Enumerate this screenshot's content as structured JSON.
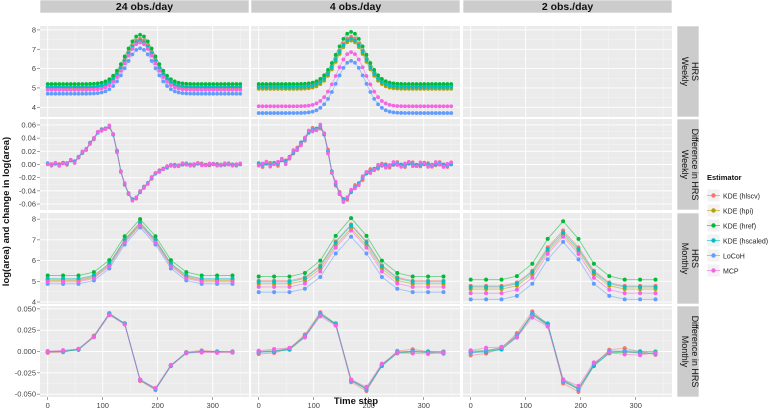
{
  "chart_data": {
    "type": "line",
    "xlabel": "Time step",
    "ylabel": "log(area) and change in log(area)",
    "columns": [
      "24 obs./day",
      "4 obs./day",
      "2 obs./day"
    ],
    "rows": [
      {
        "label": "HRS\nWeekly",
        "y_ticks": [
          4,
          5,
          6,
          7,
          8
        ],
        "ylim": [
          3.6,
          8.1
        ]
      },
      {
        "label": "Difference in HRS\nWeekly",
        "y_ticks": [
          -0.06,
          -0.04,
          -0.02,
          0.0,
          0.02,
          0.04,
          0.06
        ],
        "y_tick_labels": [
          "-0.06",
          "-0.04",
          "-0.02",
          "0.00",
          "0.02",
          "0.04",
          "0.06"
        ],
        "ylim": [
          -0.066,
          0.066
        ]
      },
      {
        "label": "HRS\nMonthly",
        "y_ticks": [
          4,
          5,
          6,
          7,
          8
        ],
        "ylim": [
          4.0,
          8.2
        ]
      },
      {
        "label": "Difference in HRS\nMonthly",
        "y_ticks": [
          -0.05,
          -0.025,
          0,
          0.025,
          0.05
        ],
        "y_tick_labels": [
          "-0.050",
          "-0.025",
          "0.000",
          "0.025",
          "0.050"
        ],
        "ylim": [
          -0.051,
          0.051
        ]
      }
    ],
    "x_ticks": [
      0,
      100,
      200,
      300
    ],
    "xlim": [
      -14,
      366
    ],
    "legend": {
      "title": "Estimator",
      "position": "right",
      "entries": [
        {
          "name": "KDE (hlscv)",
          "color": "#f8766d"
        },
        {
          "name": "KDE (hpi)",
          "color": "#b79f00"
        },
        {
          "name": "KDE (href)",
          "color": "#00ba38"
        },
        {
          "name": "KDE (hscaled)",
          "color": "#00bfc4"
        },
        {
          "name": "LoCoH",
          "color": "#619cff"
        },
        {
          "name": "MCP",
          "color": "#f564e3"
        }
      ]
    },
    "series_shape": {
      "weekly_x_step": 7,
      "weekly_x_max": 350,
      "weekly_peak": 168,
      "weekly_width": 26,
      "monthly_x": [
        0,
        28,
        56,
        84,
        112,
        140,
        168,
        196,
        224,
        252,
        280,
        308,
        336
      ]
    },
    "hrs_weekly": {
      "24 obs./day": {
        "base": [
          5.05,
          5.0,
          5.2,
          5.05,
          4.7,
          4.9
        ],
        "peak": [
          7.55,
          7.45,
          7.75,
          7.45,
          7.05,
          7.35
        ]
      },
      "4 obs./day": {
        "base": [
          5.1,
          4.95,
          5.2,
          5.05,
          3.7,
          4.05
        ],
        "peak": [
          7.65,
          7.45,
          7.9,
          7.55,
          6.4,
          6.85
        ]
      }
    },
    "hrs_monthly": {
      "24 obs./day": {
        "base": [
          5.05,
          5.0,
          5.25,
          5.1,
          4.85,
          4.95
        ],
        "peak": [
          7.85,
          7.75,
          8.0,
          7.8,
          7.6,
          7.7
        ]
      },
      "4 obs./day": {
        "base": [
          5.0,
          4.85,
          5.2,
          4.95,
          4.45,
          4.7
        ],
        "peak": [
          7.75,
          7.55,
          8.05,
          7.7,
          7.15,
          7.45
        ]
      },
      "2 obs./day": {
        "base": [
          4.75,
          4.6,
          5.05,
          4.7,
          4.1,
          4.4
        ],
        "peak": [
          7.45,
          7.25,
          7.9,
          7.35,
          6.9,
          7.15
        ]
      }
    },
    "diff_weekly": [
      0.002,
      0.0,
      0.001,
      -0.001,
      0.003,
      0.001,
      0.006,
      0.004,
      0.012,
      0.018,
      0.022,
      0.033,
      0.04,
      0.048,
      0.052,
      0.055,
      0.058,
      0.045,
      0.02,
      -0.01,
      -0.03,
      -0.045,
      -0.053,
      -0.05,
      -0.042,
      -0.035,
      -0.028,
      -0.02,
      -0.014,
      -0.01,
      -0.006,
      -0.004,
      -0.002,
      -0.001,
      -0.001,
      0.0,
      0.0,
      0.0,
      0.0,
      0.001,
      0.0,
      0.0,
      0.0,
      0.0,
      0.0,
      0.0,
      0.0,
      0.0,
      0.0,
      0.0,
      0.0
    ],
    "diff_monthly": [
      0.0,
      0.0,
      0.002,
      0.017,
      0.044,
      0.033,
      -0.033,
      -0.044,
      -0.017,
      -0.002,
      0.0,
      0.0,
      0.0
    ]
  }
}
